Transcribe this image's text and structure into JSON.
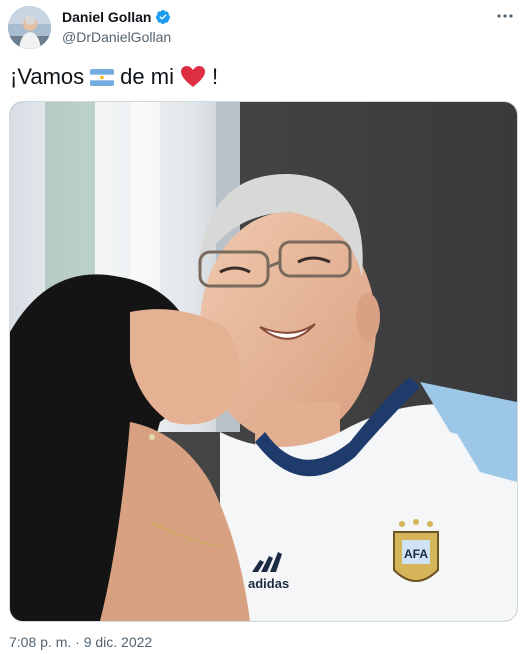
{
  "author": {
    "name": "Daniel Gollan",
    "handle": "@DrDanielGollan",
    "verified": true
  },
  "tweet": {
    "text_part1": "¡Vamos",
    "text_part2": "de mi",
    "text_part3": "!",
    "emoji_flag": "argentina-flag-icon",
    "emoji_heart": "red-heart-icon"
  },
  "media": {
    "shirt_text": "adidas",
    "badge_text": "AFA"
  },
  "timestamp": "7:08 p. m. · 9 dic. 2022",
  "colors": {
    "verified_blue": "#1d9bf0",
    "text_primary": "#0f1419",
    "text_secondary": "#536471",
    "heart_red": "#e0245e",
    "flag_blue": "#74acdf"
  }
}
